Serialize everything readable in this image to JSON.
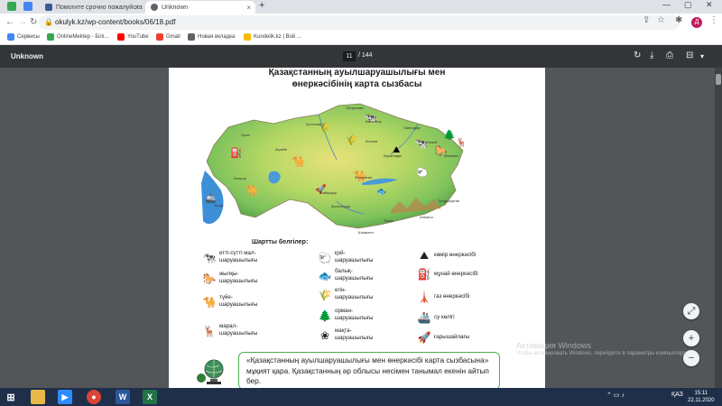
{
  "browser": {
    "tabs": [
      {
        "label": "Помогите срочно пожалуйста",
        "color": "#3b5998"
      },
      {
        "label": "Unknown",
        "color": "#5f6368"
      }
    ],
    "address": "okulyk.kz/wp-content/books/06/18.pdf",
    "bookmarks": [
      {
        "label": "Сервисы",
        "color": "#4285f4"
      },
      {
        "label": "OnlineMektep - Білі...",
        "color": "#34a853"
      },
      {
        "label": "YouTube",
        "color": "#ff0000"
      },
      {
        "label": "Gmail",
        "color": "#ea4335"
      },
      {
        "label": "Новая вкладка",
        "color": "#5f6368"
      },
      {
        "label": "Kundelik.kz | Вой ...",
        "color": "#fbbc04"
      }
    ],
    "profile_initial": "Д"
  },
  "pdf": {
    "title": "Unknown",
    "page_current": "11",
    "page_total": "/ 144"
  },
  "page": {
    "map_title_line1": "Қазақстанның ауылшаруашылығы мен",
    "map_title_line2": "өнеркәсібінің карта сызбасы",
    "cities": [
      "Петропавл",
      "Қостанай",
      "Көкшетау",
      "Павлодар",
      "Астана",
      "Орал",
      "Ақтөбе",
      "Семей",
      "Өскемен",
      "Қарағанды",
      "Жезқазған",
      "Атырау",
      "Байқоңыр",
      "Ақтау",
      "Қызылорда",
      "Талдықорған",
      "Тараз",
      "Шымкент",
      "Алматы"
    ],
    "legend_title": "Шартты белгілер:",
    "legend": [
      {
        "icon": "cow-icon",
        "glyph": "🐄",
        "label": "етті-сүтті мал-\nшаруашылығы"
      },
      {
        "icon": "horse-icon",
        "glyph": "🐎",
        "label": "жылқы-\nшаруашылығы"
      },
      {
        "icon": "camel-icon",
        "glyph": "🐪",
        "label": "түйе-\nшаруашылығы"
      },
      {
        "icon": "deer-icon",
        "glyph": "🦌",
        "label": "марал-\nшаруашылығы"
      },
      {
        "icon": "sheep-icon",
        "glyph": "🐑",
        "label": "қой-\nшаруашылығы"
      },
      {
        "icon": "fish-icon",
        "glyph": "🐟",
        "label": "балық-\nшаруашылығы"
      },
      {
        "icon": "wheat-icon",
        "glyph": "🌾",
        "label": "егін-\nшаруашылығы"
      },
      {
        "icon": "tree-icon",
        "glyph": "🌲",
        "label": "орман-\nшаруашылығы"
      },
      {
        "icon": "cotton-icon",
        "glyph": "❀",
        "label": "мақта-\nшаруашылығы"
      },
      {
        "icon": "coal-icon",
        "glyph": "⛰",
        "label": "көмір өнеркәсібі"
      },
      {
        "icon": "oil-pump-icon",
        "glyph": "⛽",
        "label": "мұнай өнеркәсібі"
      },
      {
        "icon": "gas-tower-icon",
        "glyph": "🗼",
        "label": "газ өнеркәсібі"
      },
      {
        "icon": "ship-icon",
        "glyph": "🚢",
        "label": "су көлігі"
      },
      {
        "icon": "rocket-icon",
        "glyph": "🚀",
        "label": "ғарышайлағы"
      }
    ],
    "task_text": "«Қазақстанның ауылшаруашылығы мен өнеркәсібі карта сызбасына» мұқият қара. Қазақстанның әр облысы несімен танымал екенін айтып бер."
  },
  "watermark": {
    "line1": "Активация Windows",
    "line2": "Чтобы активировать Windows, перейдите в параметры компьютера."
  },
  "taskbar": {
    "lang": "ҚАЗ",
    "time": "15:11",
    "date": "22.11.2020"
  }
}
